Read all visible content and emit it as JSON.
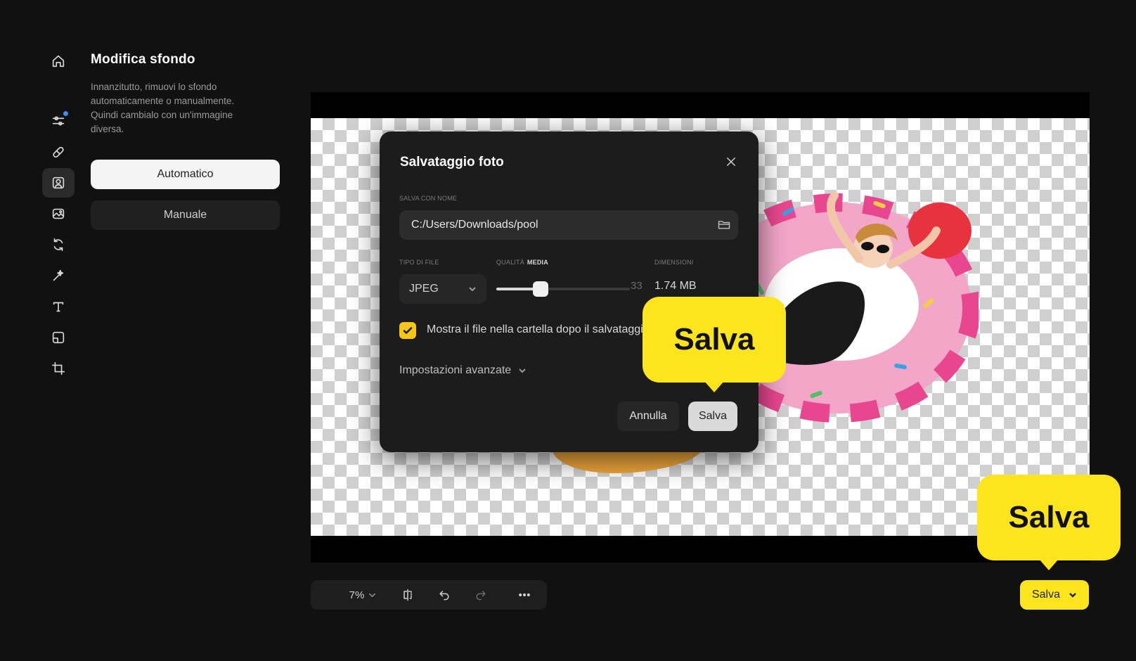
{
  "sidebar": {
    "items": [
      {
        "icon": "home-icon"
      },
      {
        "icon": "adjustments-icon",
        "has_dot": true
      },
      {
        "icon": "bandage-icon"
      },
      {
        "icon": "portrait-icon",
        "active": true
      },
      {
        "icon": "image-edit-icon"
      },
      {
        "icon": "replace-icon"
      },
      {
        "icon": "magic-wand-icon"
      },
      {
        "icon": "text-icon"
      },
      {
        "icon": "layout-icon"
      },
      {
        "icon": "crop-icon"
      }
    ]
  },
  "panel": {
    "title": "Modifica sfondo",
    "description": "Innanzitutto, rimuovi lo sfondo automaticamente o manualmente. Quindi cambialo con un'immagine diversa.",
    "auto_label": "Automatico",
    "manual_label": "Manuale"
  },
  "dialog": {
    "title": "Salvataggio foto",
    "save_as_label": "Salva con nome",
    "path_value": "C:/Users/Downloads/pool",
    "file_type_label": "Tipo di file",
    "file_type_value": "JPEG",
    "quality_label": "Qualità",
    "quality_level": "MEDIA",
    "quality_value": "33",
    "quality_fraction": 0.33,
    "size_label": "Dimensioni",
    "size_value": "1.74 MB",
    "show_in_folder_checked": true,
    "show_in_folder_label": "Mostra il file nella cartella dopo il salvataggio",
    "advanced_label": "Impostazioni avanzate",
    "cancel_label": "Annulla",
    "save_label": "Salva"
  },
  "callouts": {
    "dialog_save": "Salva",
    "main_save": "Salva"
  },
  "toolbar": {
    "zoom": "7%"
  },
  "main_save": {
    "label": "Salva"
  },
  "colors": {
    "accent": "#fde51e",
    "background": "#111111",
    "dialog": "#1c1c1c"
  }
}
